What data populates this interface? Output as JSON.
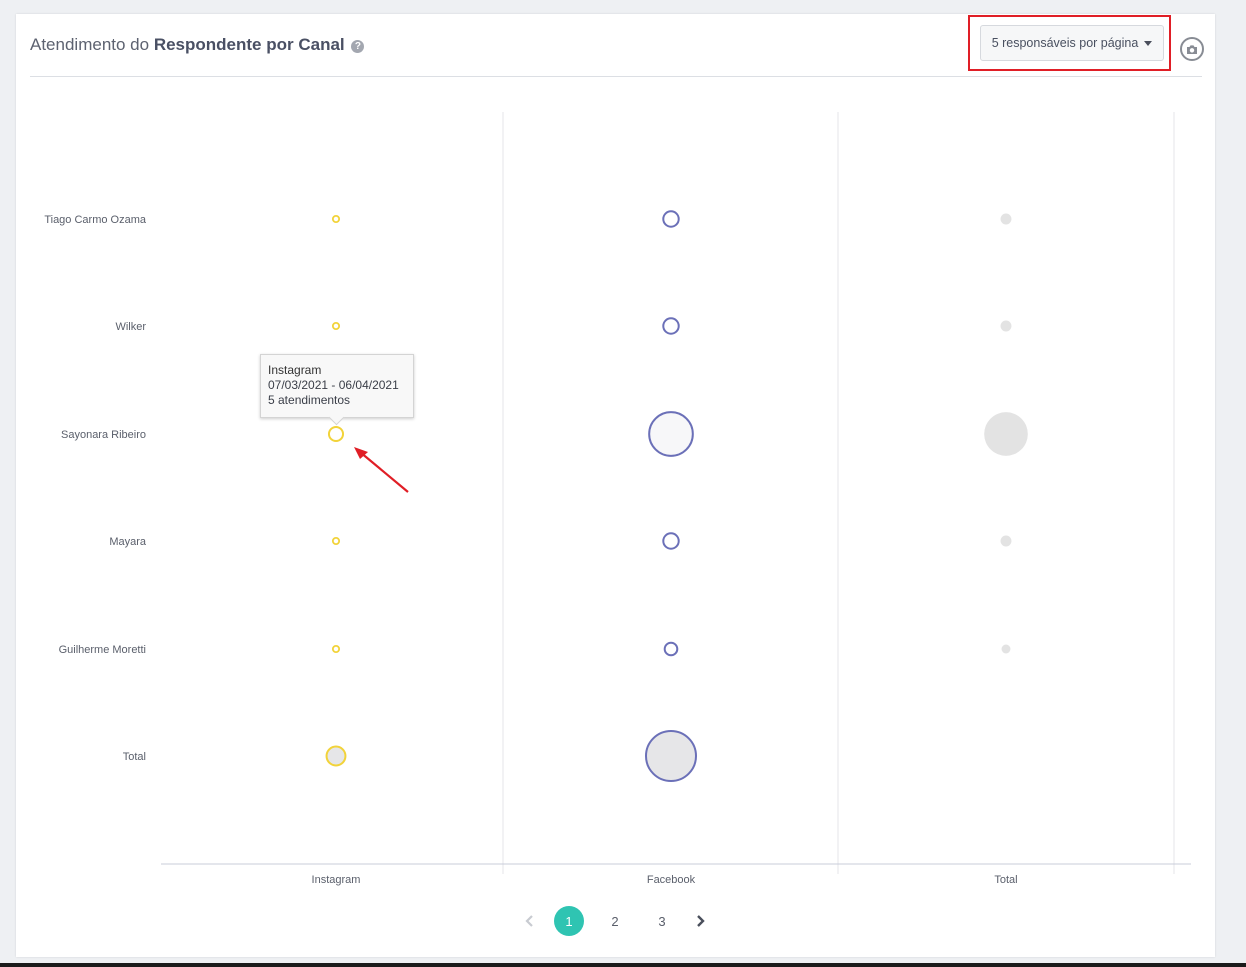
{
  "header": {
    "title_prefix": "Atendimento do",
    "title_bold": "Respondente por Canal",
    "help_icon": "question-circle-icon"
  },
  "toolbar": {
    "page_size_selected": "5 responsáveis por página",
    "camera_icon": "camera-icon"
  },
  "chart_data": {
    "type": "bubble",
    "x_categories": [
      "Instagram",
      "Facebook",
      "Total"
    ],
    "y_categories": [
      "Tiago Carmo Ozama",
      "Wilker",
      "Sayonara Ribeiro",
      "Mayara",
      "Guilherme Moretti",
      "Total"
    ],
    "series": [
      {
        "category": "Instagram",
        "color": "#f2d33a",
        "values": [
          1,
          1,
          5,
          1,
          1,
          9
        ]
      },
      {
        "category": "Facebook",
        "color": "#6b70b8",
        "values": [
          6,
          6,
          48,
          6,
          4,
          63
        ]
      },
      {
        "category": "Total",
        "color": "#e3e3e3",
        "values": [
          3,
          3,
          48,
          3,
          2,
          null
        ]
      }
    ],
    "colors": {
      "instagram": "#f2d33a",
      "facebook": "#6b70b8",
      "total": "#e3e3e3"
    }
  },
  "tooltip": {
    "title": "Instagram",
    "date_range": "07/03/2021 - 06/04/2021",
    "count_text": "5 atendimentos"
  },
  "pagination": {
    "pages": [
      "1",
      "2",
      "3"
    ],
    "current": "1",
    "prev_icon": "chevron-left-icon",
    "next_icon": "chevron-right-icon"
  }
}
